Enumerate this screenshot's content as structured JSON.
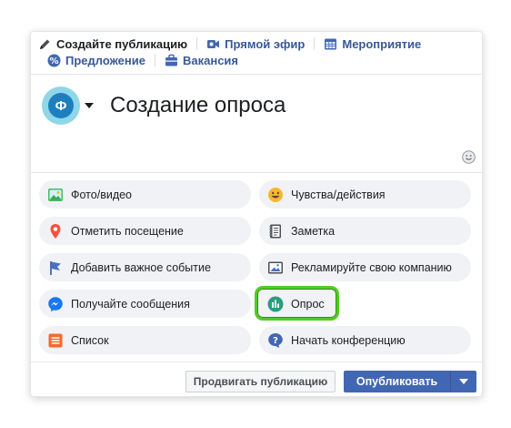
{
  "top_actions": {
    "create_post": "Создайте публикацию",
    "live_video": "Прямой эфир",
    "event": "Мероприятие",
    "offer": "Предложение",
    "job": "Вакансия"
  },
  "composer": {
    "avatar_letter": "Ф",
    "title": "Создание опроса"
  },
  "options": [
    {
      "label": "Фото/видео",
      "icon": "photo-icon"
    },
    {
      "label": "Чувства/действия",
      "icon": "smiley-icon"
    },
    {
      "label": "Отметить посещение",
      "icon": "location-pin-icon"
    },
    {
      "label": "Заметка",
      "icon": "note-icon"
    },
    {
      "label": "Добавить важное событие",
      "icon": "flag-icon"
    },
    {
      "label": "Рекламируйте свою компанию",
      "icon": "advert-icon"
    },
    {
      "label": "Получайте сообщения",
      "icon": "messenger-icon"
    },
    {
      "label": "Опрос",
      "icon": "poll-icon"
    },
    {
      "label": "Список",
      "icon": "list-icon"
    },
    {
      "label": "Начать конференцию",
      "icon": "question-icon"
    }
  ],
  "footer": {
    "promote_label": "Продвигать публикацию",
    "publish_label": "Опубликовать"
  },
  "colors": {
    "accent": "#4267b2",
    "highlight": "#55c925",
    "link": "#385898"
  }
}
